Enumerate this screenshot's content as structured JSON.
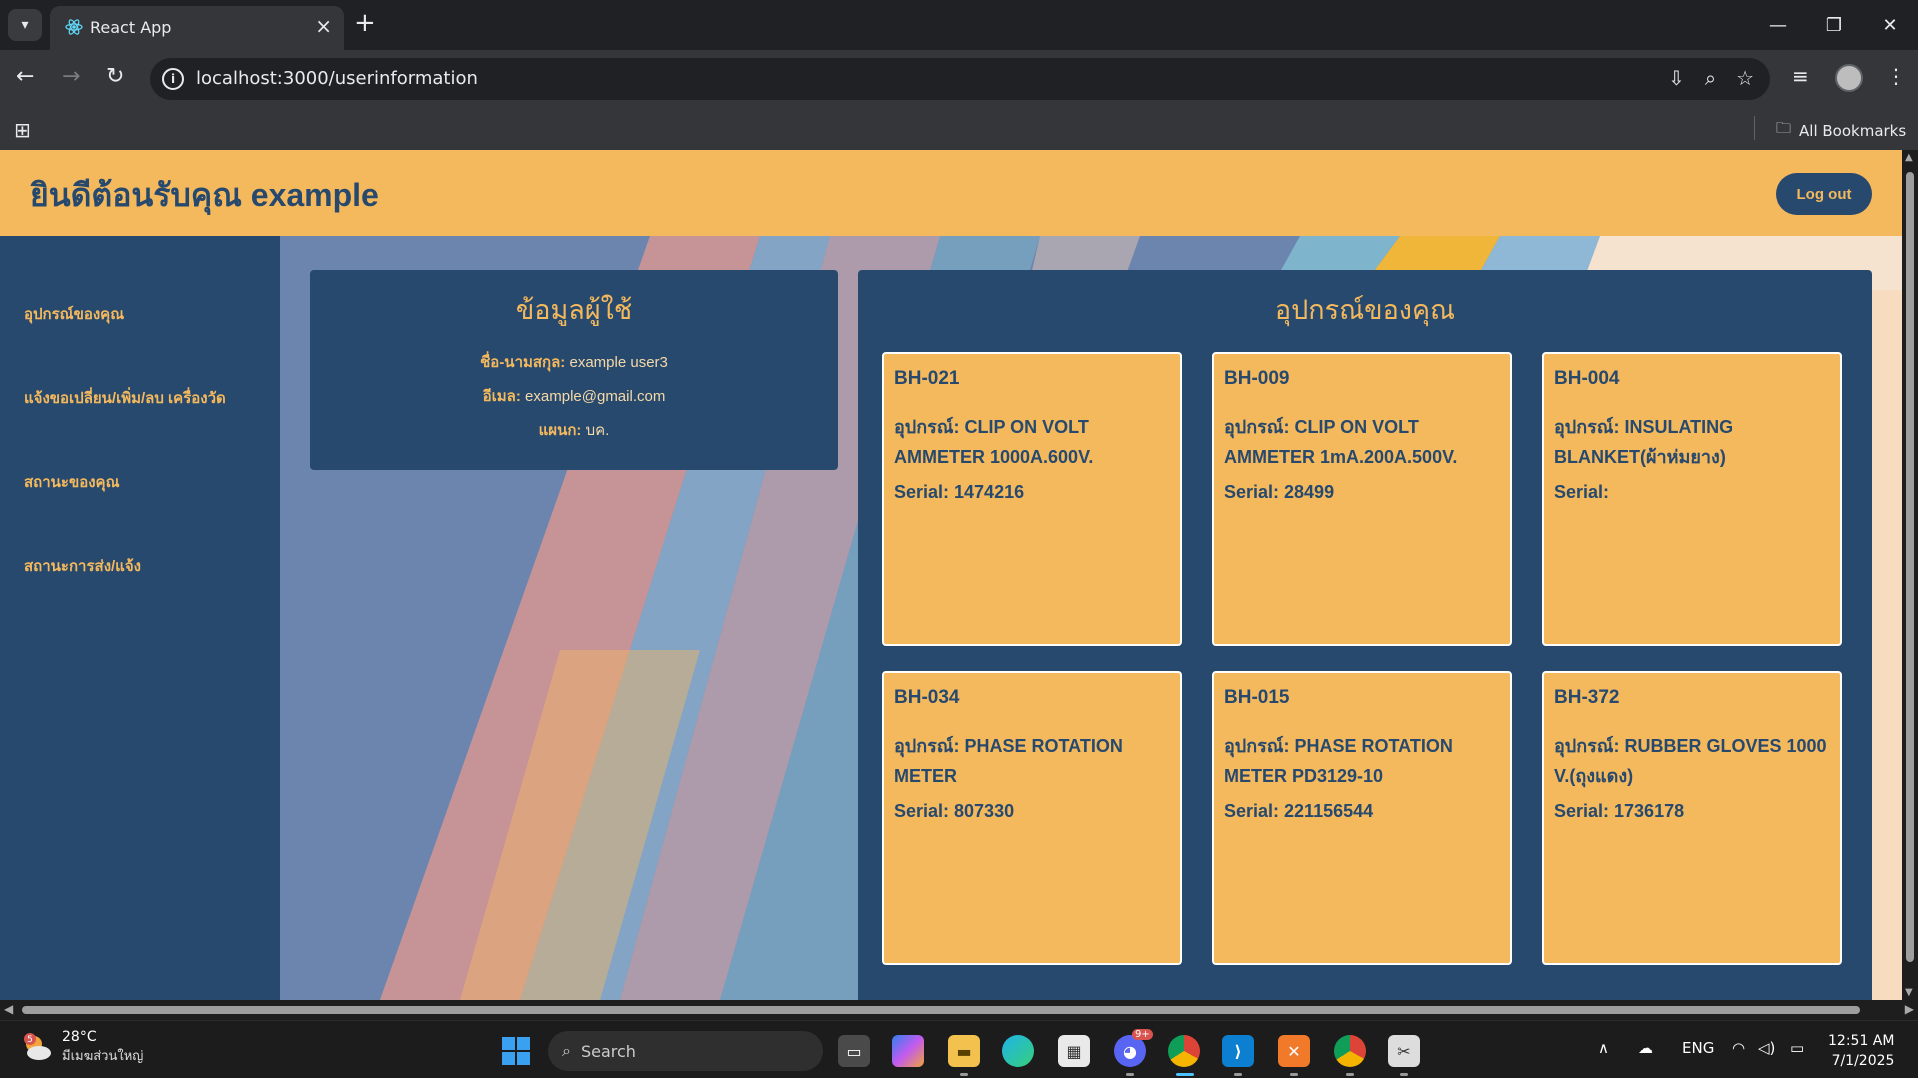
{
  "browser": {
    "tab_title": "React App",
    "url": "localhost:3000/userinformation",
    "bookmarks_label": "All Bookmarks"
  },
  "header": {
    "title": "ยินดีต้อนรับคุณ example",
    "logout_label": "Log out"
  },
  "sidebar": {
    "items": [
      {
        "label": "อุปกรณ์ของคุณ"
      },
      {
        "label": "แจ้งขอเปลี่ยน/เพิ่ม/ลบ เครื่องวัด"
      },
      {
        "label": "สถานะของคุณ"
      },
      {
        "label": "สถานะการส่ง/แจ้ง"
      }
    ]
  },
  "user_info": {
    "title": "ข้อมูลผู้ใช้",
    "name_label": "ชื่อ-นามสกุล:",
    "name_value": "example user3",
    "email_label": "อีเมล:",
    "email_value": "example@gmail.com",
    "dept_label": "แผนก:",
    "dept_value": "บค."
  },
  "devices": {
    "title": "อุปกรณ์ของคุณ",
    "items": [
      {
        "code": "BH-021",
        "device": "อุปกรณ์: CLIP ON VOLT AMMETER 1000A.600V.",
        "serial": "Serial: 1474216"
      },
      {
        "code": "BH-009",
        "device": "อุปกรณ์: CLIP ON VOLT AMMETER 1mA.200A.500V.",
        "serial": "Serial: 28499"
      },
      {
        "code": "BH-004",
        "device": "อุปกรณ์: INSULATING BLANKET(ผ้าห่มยาง)",
        "serial": "Serial:"
      },
      {
        "code": "BH-034",
        "device": "อุปกรณ์: PHASE ROTATION METER",
        "serial": "Serial: 807330"
      },
      {
        "code": "BH-015",
        "device": "อุปกรณ์: PHASE ROTATION METER PD3129-10",
        "serial": "Serial: 221156544"
      },
      {
        "code": "BH-372",
        "device": "อุปกรณ์: RUBBER GLOVES 1000 V.(ถุงแดง)",
        "serial": "Serial: 1736178"
      }
    ]
  },
  "taskbar": {
    "weather_temp": "28°C",
    "weather_location": "มีเมฆส่วนใหญ่",
    "weather_badge": "5",
    "search_placeholder": "Search",
    "discord_badge": "9+",
    "language": "ENG",
    "time": "12:51 AM",
    "date": "7/1/2025"
  },
  "colors": {
    "navy": "#27496d",
    "amber": "#f5b95d"
  }
}
